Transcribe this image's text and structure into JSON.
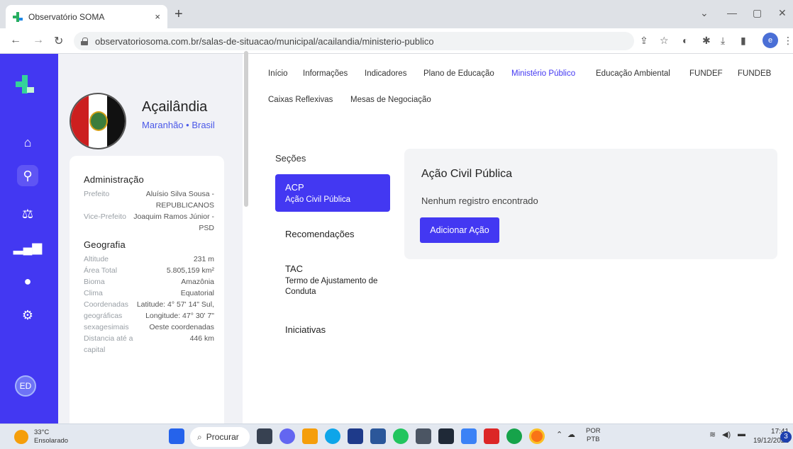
{
  "browser": {
    "tab_title": "Observatório SOMA",
    "tab_close": "×",
    "new_tab": "+",
    "url": "observatoriosoma.com.br/salas-de-situacao/municipal/acailandia/ministerio-publico",
    "profile_initial": "e"
  },
  "rail": {
    "avatar": "ED",
    "items": [
      "home-icon",
      "location-pin-icon",
      "scales-icon",
      "bar-chart-icon",
      "chat-icon",
      "gear-icon"
    ]
  },
  "city": {
    "name": "Açailândia",
    "location": "Maranhão • Brasil"
  },
  "info": {
    "admin_title": "Administração",
    "prefeito_label": "Prefeito",
    "prefeito_value": "Aluísio Silva Sousa - REPUBLICANOS",
    "vice_label": "Vice-Prefeito",
    "vice_value": "Joaquim Ramos Júnior - PSD",
    "geo_title": "Geografia",
    "altitude_label": "Altitude",
    "altitude_value": "231 m",
    "area_label": "Área Total",
    "area_value": "5.805,159 km²",
    "bioma_label": "Bioma",
    "bioma_value": "Amazônia",
    "clima_label": "Clima",
    "clima_value": "Equatorial",
    "coords_label": "Coordenadas geográficas sexagesimais",
    "coords_value": "Latitude: 4° 57' 14\" Sul, Longitude: 47° 30' 7\" Oeste coordenadas",
    "dist_label": "Distancia até a capital",
    "dist_value": "446 km"
  },
  "nav": {
    "items": [
      "Início",
      "Informações",
      "Indicadores",
      "Plano de Educação",
      "Ministério Público",
      "Educação Ambiental",
      "FUNDEF",
      "FUNDEB",
      "Caixas Reflexivas",
      "Mesas de Negociação"
    ],
    "active": "Ministério Público"
  },
  "sections": {
    "title": "Seções",
    "acp_title": "ACP",
    "acp_sub": "Ação Civil Pública",
    "recomendacoes": "Recomendações",
    "tac_title": "TAC",
    "tac_sub": "Termo de Ajustamento de Conduta",
    "iniciativas": "Iniciativas"
  },
  "content": {
    "title": "Ação Civil Pública",
    "empty": "Nenhum registro encontrado",
    "add_button": "Adicionar Ação"
  },
  "taskbar": {
    "temp": "33°C",
    "weather": "Ensolarado",
    "search": "Procurar",
    "lang1": "POR",
    "lang2": "PTB",
    "time": "17:41",
    "date": "19/12/2022",
    "notifications": "3"
  },
  "colors": {
    "accent": "#4338f2",
    "rail": "#4338f2",
    "logo_green": "#34d399"
  }
}
